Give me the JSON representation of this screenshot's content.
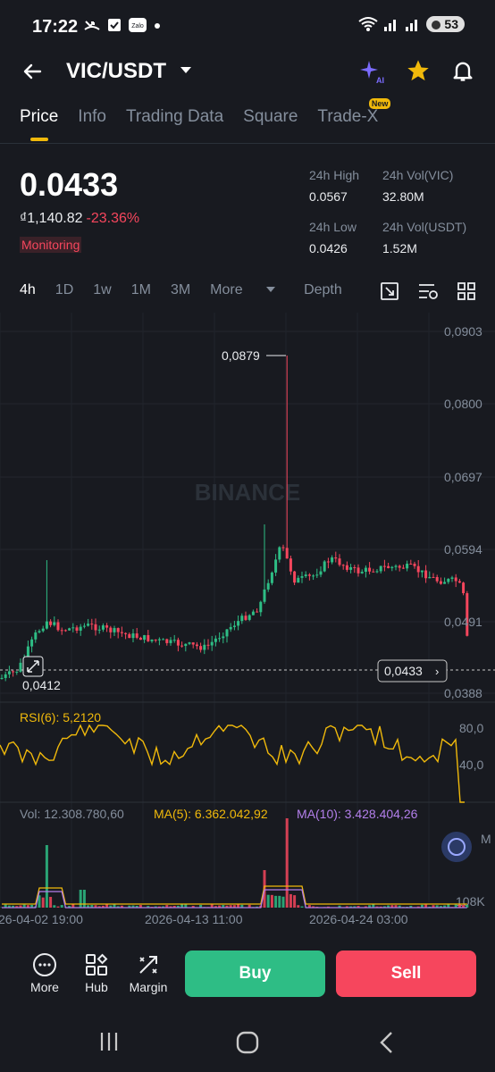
{
  "status_bar": {
    "time": "17:22",
    "battery": "53"
  },
  "header": {
    "pair": "VIC/USDT"
  },
  "tabs": [
    {
      "label": "Price",
      "active": true
    },
    {
      "label": "Info"
    },
    {
      "label": "Trading Data"
    },
    {
      "label": "Square"
    },
    {
      "label": "Trade-X",
      "badge": "New"
    }
  ],
  "ticker": {
    "price": "0.0433",
    "fiat": "₫1,140.82",
    "change": "-23.36%",
    "tag": "Monitoring",
    "high_label": "24h High",
    "high": "0.0567",
    "vol_base_label": "24h Vol(VIC)",
    "vol_base": "32.80M",
    "low_label": "24h Low",
    "low": "0.0426",
    "vol_quote_label": "24h Vol(USDT)",
    "vol_quote": "1.52M"
  },
  "timeframes": {
    "items": [
      "4h",
      "1D",
      "1w",
      "1M",
      "3M"
    ],
    "more": "More",
    "depth": "Depth",
    "active": "4h"
  },
  "chart": {
    "watermark": "BINANCE",
    "y_ticks": [
      "0,0903",
      "0,0800",
      "0,0697",
      "0,0594",
      "0,0491",
      "0,0388"
    ],
    "max_label": "0,0879",
    "min_label": "0,0412",
    "current_label": "0,0433",
    "rsi_label": "RSI(6): 5,2120",
    "rsi_ticks": [
      "80,0",
      "40,0"
    ],
    "vol_label": "Vol: 12.308.780,60",
    "ma5_label": "MA(5): 6.362.042,92",
    "ma10_label": "MA(10): 3.428.404,26",
    "vol_tick_top": "M",
    "vol_tick_bottom": "108K",
    "x_ticks": [
      "26-04-02 19:00",
      "2026-04-13 11:00",
      "2026-04-24 03:00"
    ],
    "colors": {
      "up": "#2ebd85",
      "down": "#f6465d",
      "rsi": "#f0b90b",
      "ma10": "#b37feb"
    }
  },
  "actions": {
    "more": "More",
    "hub": "Hub",
    "margin": "Margin",
    "buy": "Buy",
    "sell": "Sell"
  }
}
